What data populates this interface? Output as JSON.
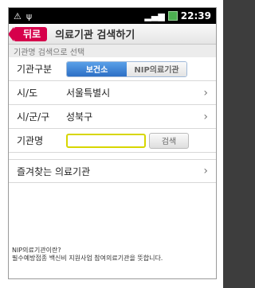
{
  "status": {
    "left_icons": [
      "alert-icon",
      "usb-icon"
    ],
    "time": "22:39"
  },
  "header": {
    "back_label": "뒤로",
    "title": "의료기관 검색하기"
  },
  "section": {
    "title": "기관명 검색으로 선택"
  },
  "type_row": {
    "label": "기관구분",
    "options": [
      "보건소",
      "NIP의료기관"
    ],
    "selected_index": 0
  },
  "city_row": {
    "label": "시/도",
    "value": "서울특별시"
  },
  "district_row": {
    "label": "시/군/구",
    "value": "성북구"
  },
  "name_row": {
    "label": "기관명",
    "input_value": "",
    "search_label": "검색"
  },
  "favorites": {
    "label": "즐겨찾는 의료기관"
  },
  "footer": {
    "line1": "NIP의료기관이란?",
    "line2": "필수예방접종 백신비 지원사업 참여의료기관을 뜻합니다."
  },
  "colors": {
    "accent_back": "#d6004b",
    "selected_seg": "#2c6fc5"
  }
}
